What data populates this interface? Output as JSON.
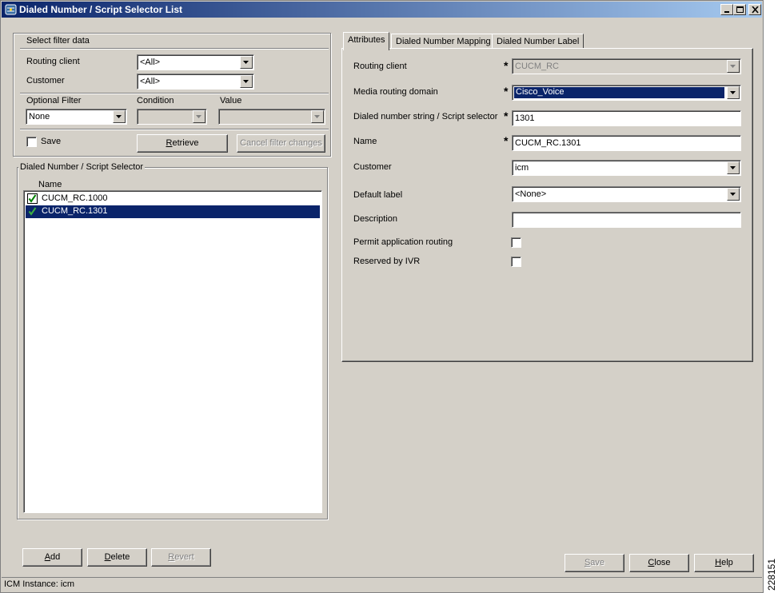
{
  "window": {
    "title": "Dialed Number / Script Selector List",
    "icon": "network-app-icon",
    "controls": [
      "minimize-icon",
      "maximize-icon",
      "close-icon"
    ]
  },
  "filter": {
    "caption": "Select filter data",
    "routing_client_label": "Routing client",
    "routing_client_value": "<All>",
    "customer_label": "Customer",
    "customer_value": "<All>",
    "optional_filter_label": "Optional Filter",
    "optional_filter_value": "None",
    "condition_label": "Condition",
    "value_label": "Value",
    "save_label": "Save",
    "save_checked": false,
    "retrieve_label": "Retrieve",
    "retrieve_mnemonic": "R",
    "retrieve_rest": "etrieve",
    "cancel_label": "Cancel filter changes"
  },
  "selector_list": {
    "caption": "Dialed Number / Script Selector",
    "column_header": "Name",
    "rows": [
      {
        "name": "CUCM_RC.1000",
        "icon": "checkmark-icon",
        "selected": false
      },
      {
        "name": "CUCM_RC.1301",
        "icon": "checkmark-icon",
        "selected": true
      }
    ],
    "add_label": "Add",
    "add_mnemonic": "A",
    "add_rest": "dd",
    "delete_label": "Delete",
    "delete_mnemonic": "D",
    "delete_rest": "elete",
    "revert_label": "Revert",
    "revert_mnemonic": "R",
    "revert_rest": "evert"
  },
  "tabs": [
    {
      "label": "Attributes",
      "active": true
    },
    {
      "label": "Dialed Number Mapping",
      "active": false
    },
    {
      "label": "Dialed Number Label",
      "active": false
    }
  ],
  "attributes": {
    "routing_client_label": "Routing client",
    "routing_client_value": "CUCM_RC",
    "media_routing_domain_label": "Media routing domain",
    "media_routing_domain_value": "Cisco_Voice",
    "dialed_number_label": "Dialed number string / Script selector",
    "dialed_number_value": "1301",
    "name_label": "Name",
    "name_value": "CUCM_RC.1301",
    "customer_label": "Customer",
    "customer_value": "icm",
    "default_label_label": "Default label",
    "default_label_value": "<None>",
    "description_label": "Description",
    "description_value": "",
    "permit_routing_label": "Permit application routing",
    "permit_routing_checked": false,
    "reserved_ivr_label": "Reserved by IVR",
    "reserved_ivr_checked": false,
    "required_marker": "*"
  },
  "footer": {
    "save_label": "Save",
    "save_mnemonic": "S",
    "save_rest": "ave",
    "close_label": "Close",
    "close_mnemonic": "C",
    "close_rest": "lose",
    "help_label": "Help",
    "help_mnemonic": "H",
    "help_rest": "elp"
  },
  "status": {
    "text": "ICM Instance: icm"
  },
  "figure_id": "228151",
  "colors": {
    "face": "#d4d0c8",
    "selection": "#0a246a",
    "title_start": "#0a246a",
    "title_end": "#a6caf0",
    "check_green": "#008000"
  }
}
